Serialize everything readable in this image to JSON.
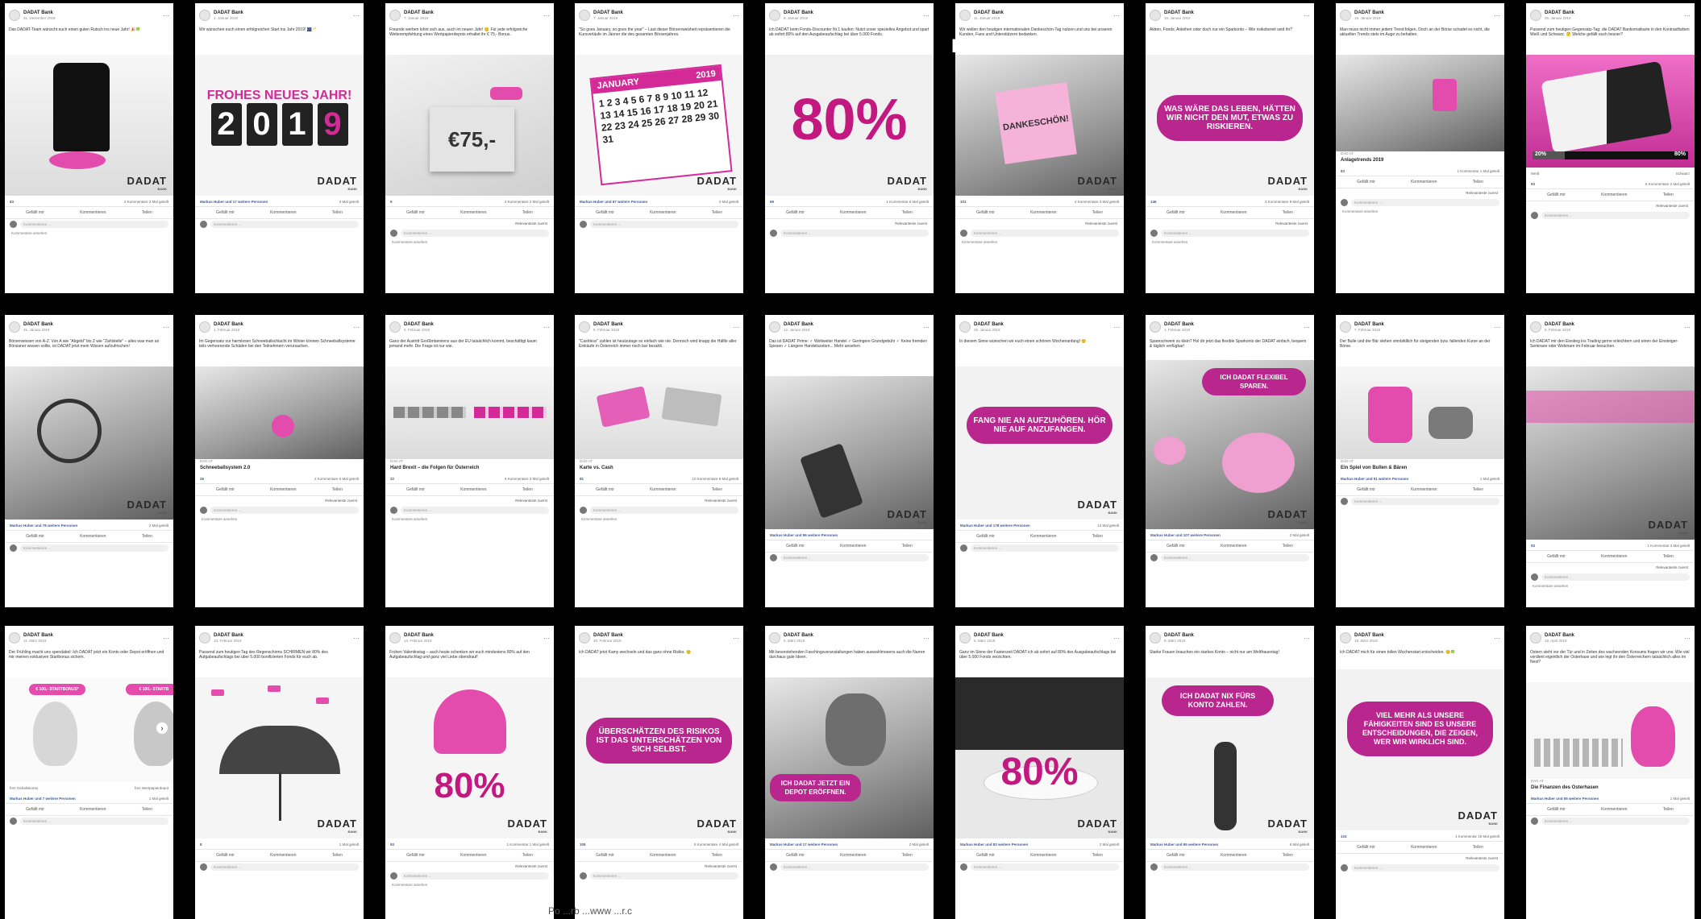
{
  "page": {
    "title": "F",
    "footer": "Po                    ...rb                    ...www                    ...r.c"
  },
  "common": {
    "page_name": "DADAT Bank",
    "like": "Gefällt mir",
    "comment": "Kommentieren",
    "share": "Teilen",
    "relevant": "Relevanteste zuerst",
    "comment_placeholder": "Kommentieren ...",
    "show_comments": "Kommentare ansehen",
    "logo": "DADAT",
    "logo_sub": "BANK"
  },
  "posts": [
    {
      "date": "31. Dezember 2018",
      "caption": "Das DADAT-Team wünscht euch einen guten Rutsch ins neue Jahr! 🎉🍀",
      "reactions": "83",
      "stats": "2 Kommentare  3 Mal geteilt"
    },
    {
      "date": "1. Januar 2019",
      "caption": "Wir wünschen euch einen erfolgreichen Start ins Jahr 2019! 🎆🥂",
      "headline": "FROHES NEUES JAHR!",
      "digits": [
        "2",
        "0",
        "1",
        "9"
      ],
      "reactions": "Markus Huber und 17 weitere Personen",
      "stats": "3 Mal geteilt"
    },
    {
      "date": "7. Januar 2019",
      "caption": "Freunde werben lohnt sich aus, auch im neuen Jahr! 😊 Für jede erfolgreiche Weiterempfehlung eines Wertpapierdepots erhaltet ihr € 75,- Bonus.",
      "link": "www.dad.at/Service/Service/Freunde-werben",
      "price": "€75,-",
      "reactions": "9",
      "stats": "2 Kommentare  2 Mal geteilt"
    },
    {
      "date": "7. Januar 2019",
      "caption": "\"So goes January, so goes the year\" – Laut dieser Börsenweisheit repräsentieren die Kursverläufe im Jänner die des gesamten Börsenjahres.",
      "calendar_month": "JANUARY",
      "calendar_year": "2019",
      "calendar_days": "1 2 3 4 5 6 7 8 9 10 11 12 13 14 15 16 17 18 19 20 21 22 23 24 25 26 27 28 29 30 31",
      "reactions": "Markus Huber und 67 weitere Personen",
      "stats": "4 Mal geteilt"
    },
    {
      "date": "8. Januar 2019",
      "caption": "Ich DADAT beim Fonds-Discounter Nr.1 kaufen: Nutzt unser spezielles Angebot und spart ab sofort 80% auf den Ausgabeaufschlag bei über 5.000 Fonds.",
      "link": "www.dad.at/Boerse-Depot/Depot-Trading/Fondsaktion",
      "big": "80%",
      "reactions": "69",
      "stats": "1 Kommentar  6 Mal geteilt"
    },
    {
      "date": "11. Januar 2019",
      "caption": "Wir wollen den heutigen internationalen Dankeschön-Tag nutzen und uns bei unseren Kunden, Fans und Unterstützern bedanken.",
      "note": "DANKESCHÖN!",
      "reactions": "101",
      "stats": "2 Kommentare  3 Mal geteilt"
    },
    {
      "date": "16. Januar 2019",
      "caption": "Aktien, Fonds, Anleihen oder doch nur ein Sparkonto – Wie risikobereit seid ihr?",
      "bubble": "WAS WÄRE DAS LEBEN, HÄTTEN WIR NICHT DEN MUT, ETWAS ZU RISKIEREN.",
      "reactions": "146",
      "stats": "3 Kommentare  9 Mal geteilt"
    },
    {
      "date": "18. Januar 2019",
      "caption": "Man muss nicht immer jedem Trend folgen. Doch an der Börse schadet es nicht, die aktuellen Trends stets im Auge zu behalten.",
      "title": "Anlagetrends 2019",
      "reactions": "63",
      "stats": "1 Kommentar  1 Mal geteilt"
    },
    {
      "date": "25. Januar 2019",
      "caption": "Passend zum heutigen Gegensatz-Tag: die DADAT Bankomatkarte in den Kontrastfarben Weiß und Schwarz. 🤔 Welche gefällt euch besser?",
      "poll_left": "20%",
      "poll_right": "80%",
      "opt_left": "Weiß",
      "opt_right": "Schwarz",
      "reactions": "93",
      "stats": "5 Kommentare  2 Mal geteilt"
    },
    {
      "date": "31. Januar 2019",
      "caption": "Börsenwissen von A-Z: Von A wie \"Abgeld\" bis Z wie \"Zahlstelle\" – alles was man an Börsianer wissen sollte, ist DADAT jetzt mein Wissen aufzufrischen!",
      "link": "www.dad.at/Service/Boerse-Wissen/Boersenlexikon",
      "reactions": "Markus Huber und 78 weitere Personen",
      "stats": "2 Mal geteilt"
    },
    {
      "date": "1. Februar 2019",
      "caption": "Im Gegensatz zur harmlosen Schneeballschlacht im Winter können Schneeballsysteme teils verheerende Schäden bei den Teilnehmern verursachen.",
      "title": "Schneeballsystem 2.0",
      "reactions": "26",
      "stats": "2 Kommentare  6 Mal geteilt"
    },
    {
      "date": "5. Februar 2019",
      "caption": "Ganz der Austritt Großbritanniens aus der EU tatsächlich kommt, beschäftigt kaum jemand mehr. Die Frage ist nur wie.",
      "title": "Hard Brexit – die Folgen für Österreich",
      "reactions": "22",
      "stats": "6 Kommentare  3 Mal geteilt"
    },
    {
      "date": "8. Februar 2019",
      "caption": "\"Cashless\" zahlen ist heutzutage so einfach wie nie. Dennoch wird knapp die Hälfte aller Einkäufe in Österreich immer noch bar bezahlt.",
      "title": "Karte vs. Cash",
      "reactions": "81",
      "stats": "10 Kommentare  9 Mal geteilt"
    },
    {
      "date": "12. Januar 2019",
      "caption": "Das ist DADAT Prime: ✓ Weltweiter Handel ✓ Geringere Grundgebühr ✓ Keine fremden Spesen ✓ Längere Handelszeiten... Mehr ansehen",
      "reactions": "Markus Huber und 96 weitere Personen",
      "stats": ""
    },
    {
      "date": "26. Januar 2019",
      "caption": "In diesem Sinne wünschen wir euch einen schönen Wochenanfang! 😊",
      "bubble": "FANG NIE AN AUFZUHÖREN. HÖR NIE AUF ANZUFANGEN.",
      "reactions": "Markus Huber und 178 weitere Personen",
      "stats": "14 Mal geteilt"
    },
    {
      "date": "1. Februar 2019",
      "caption": "Spareschwein zu klein? Hol dir jetzt das flexible Sparkonto der DADAT einfach, bequem & täglich verfügbar!",
      "link": "www.dad.at/sparkonto",
      "bubble": "ICH DADAT FLEXIBEL SPAREN.",
      "reactions": "Markus Huber und 107 weitere Personen",
      "stats": "2 Mal geteilt"
    },
    {
      "date": "7. Februar 2019",
      "caption": "Der Bulle und der Bär stehen sinnbildlich für steigenden bzw. fallenden Kurse an der Börse.",
      "title": "Ein Spiel von Bullen & Bären",
      "reactions": "Markus Huber und 51 weitere Personen",
      "stats": "1 Mal geteilt"
    },
    {
      "date": "9. Februar 2019",
      "caption": "Ich DADAT mir den Einstieg ins Trading gerne erleichtern und einen der Einsteiger-Seminare oder Webinare im Februar besuchen.",
      "link": "www.dad.at/Service/Boerse-Wissen/Webinare-Seminare",
      "reactions": "93",
      "stats": "1 Kommentar  3 Mal geteilt"
    },
    {
      "date": "11. März 2019",
      "caption": "Der Frühling macht uns spendabel: Ich DADAT jetzt ein Konto oder Depot eröffnen und mir meinen exklusiven Startbonus sichern.",
      "offer1": "€ 100,- STARTBONUS*",
      "offer2": "€ 100,- STARTB",
      "opt1": "fürs Gehaltskonto",
      "opt2": "fürs Wertpapierdepot",
      "reactions": "Markus Huber und 7 weitere Personen",
      "stats": "1 Mal geteilt"
    },
    {
      "date": "13. Februar 2019",
      "caption": "Passend zum heutigen Tag des Regenschirms SCHIRMEN wir 80% des Aufgabeaufschlags bei über 5.000 bonifizierten Fonds für euch ab.",
      "link": "www.dad.at/depot",
      "reactions": "8",
      "stats": "1 Mal geteilt"
    },
    {
      "date": "14. Februar 2019",
      "caption": "Frohen Valentinstag – auch heute schenken wir euch mindestens 80% auf den Aufgabeaufschlag und ganz viel Liebe obendrauf!",
      "link": "www.dad.at/depot",
      "big": "80%",
      "reactions": "93",
      "stats": "1 Kommentar  1 Mal geteilt"
    },
    {
      "date": "20. Februar 2019",
      "caption": "Ich DADAT jetzt Kamy wechseln und das ganz ohne Risiko. 😊",
      "link": "www.dad.at/Gehaltskonto",
      "bubble": "ÜBERSCHÄTZEN DES RISIKOS IST DAS UNTERSCHÄTZEN VON SICH SELBST.",
      "reactions": "105",
      "stats": "6 Kommentare  4 Mal geteilt"
    },
    {
      "date": "5. März 2019",
      "caption": "Mit bevorstehenden Faschingsveranstaltungen haben auswahlmoeens auch die Narren durchaus gute Ideen.",
      "link": "www.dad.at/depot",
      "bubble": "ICH DADAT JETZT EIN DEPOT ERÖFFNEN.",
      "reactions": "Markus Huber und 17 weitere Personen",
      "stats": "2 Mal geteilt"
    },
    {
      "date": "6. März 2019",
      "caption": "Ganz im Sinne der Fastenzeit DADAT ich ab sofort auf 80% des Ausgabeaufschlags bei über 5.000 Fonds verzichten.",
      "link": "www.dad.at/depot",
      "big": "80%",
      "reactions": "Markus Huber und 83 weitere Personen",
      "stats": "2 Mal geteilt"
    },
    {
      "date": "8. März 2019",
      "caption": "Starke Frauen brauchen ein starkes Konto – nicht nur am Weltfrauentag!",
      "link": "www.dad.at/gehaltskonto",
      "bubble": "ICH DADAT NIX FÜRS KONTO ZAHLEN.",
      "reactions": "Markus Huber und 65 weitere Personen",
      "stats": "6 Mal geteilt"
    },
    {
      "date": "19. März 2019",
      "caption": "Ich DADAT mich für einen tollen Wochenstart entscheiden. 😊🍀",
      "bubble": "VIEL MEHR ALS UNSERE FÄHIGKEITEN SIND ES UNSERE ENTSCHEIDUNGEN, DIE ZEIGEN, WER WIR WIRKLICH SIND.",
      "reactions": "124",
      "stats": "1 Kommentar  19 Mal geteilt"
    },
    {
      "date": "18. April 2019",
      "caption": "Ostern steht vor der Tür und in Zeiten des wachsenden Konsums fragen wir uns: Wie viel verdient eigentlich der Osterhase und wie legt ihr den Österreichern tatsächlich alles im Nest?",
      "title": "Die Finanzen des Osterhasen",
      "reactions": "Markus Huber und 55 weitere Personen",
      "stats": "1 Mal geteilt"
    }
  ]
}
